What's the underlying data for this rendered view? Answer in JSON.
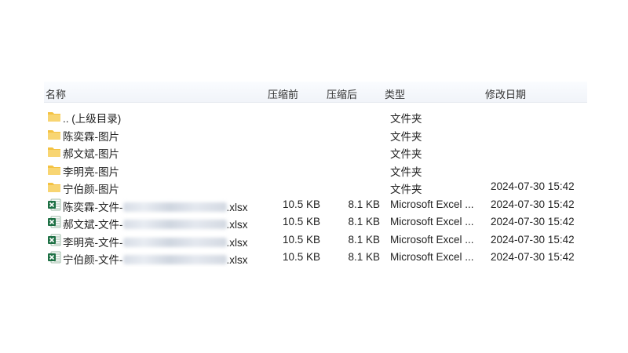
{
  "header": {
    "name": "名称",
    "compressed_size": "压缩前",
    "uncompressed_size": "压缩后",
    "type": "类型",
    "modified": "修改日期"
  },
  "rows": [
    {
      "kind": "folder",
      "icon": "folder-icon",
      "name": ".. (上级目录)",
      "name_suffix": "",
      "csize": "",
      "ucsize": "",
      "type": "文件夹",
      "date": ""
    },
    {
      "kind": "folder",
      "icon": "folder-icon",
      "name": "陈奕霖-图片",
      "name_suffix": "",
      "csize": "",
      "ucsize": "",
      "type": "文件夹",
      "date": ""
    },
    {
      "kind": "folder",
      "icon": "folder-icon",
      "name": "郝文斌-图片",
      "name_suffix": "",
      "csize": "",
      "ucsize": "",
      "type": "文件夹",
      "date": ""
    },
    {
      "kind": "folder",
      "icon": "folder-icon",
      "name": "李明亮-图片",
      "name_suffix": "",
      "csize": "",
      "ucsize": "",
      "type": "文件夹",
      "date": ""
    },
    {
      "kind": "folder",
      "icon": "folder-icon",
      "name": "宁伯颜-图片",
      "name_suffix": "",
      "csize": "",
      "ucsize": "",
      "type": "文件夹",
      "date": "2024-07-30 15:42"
    },
    {
      "kind": "excel",
      "icon": "excel-icon",
      "name": "陈奕霖-文件-",
      "name_suffix": ".xlsx",
      "csize": "10.5 KB",
      "ucsize": "8.1 KB",
      "type": "Microsoft Excel ...",
      "date": "2024-07-30 15:42"
    },
    {
      "kind": "excel",
      "icon": "excel-icon",
      "name": "郝文斌-文件-",
      "name_suffix": ".xlsx",
      "csize": "10.5 KB",
      "ucsize": "8.1 KB",
      "type": "Microsoft Excel ...",
      "date": "2024-07-30 15:42"
    },
    {
      "kind": "excel",
      "icon": "excel-icon",
      "name": "李明亮-文件-",
      "name_suffix": ".xlsx",
      "csize": "10.5 KB",
      "ucsize": "8.1 KB",
      "type": "Microsoft Excel ...",
      "date": "2024-07-30 15:42"
    },
    {
      "kind": "excel",
      "icon": "excel-icon",
      "name": "宁伯颜-文件-",
      "name_suffix": ".xlsx",
      "csize": "10.5 KB",
      "ucsize": "8.1 KB",
      "type": "Microsoft Excel ...",
      "date": "2024-07-30 15:42"
    }
  ],
  "colors": {
    "folder": "#f4c242",
    "excel_green": "#1d7044",
    "header_bg": "#f1f4f9"
  }
}
